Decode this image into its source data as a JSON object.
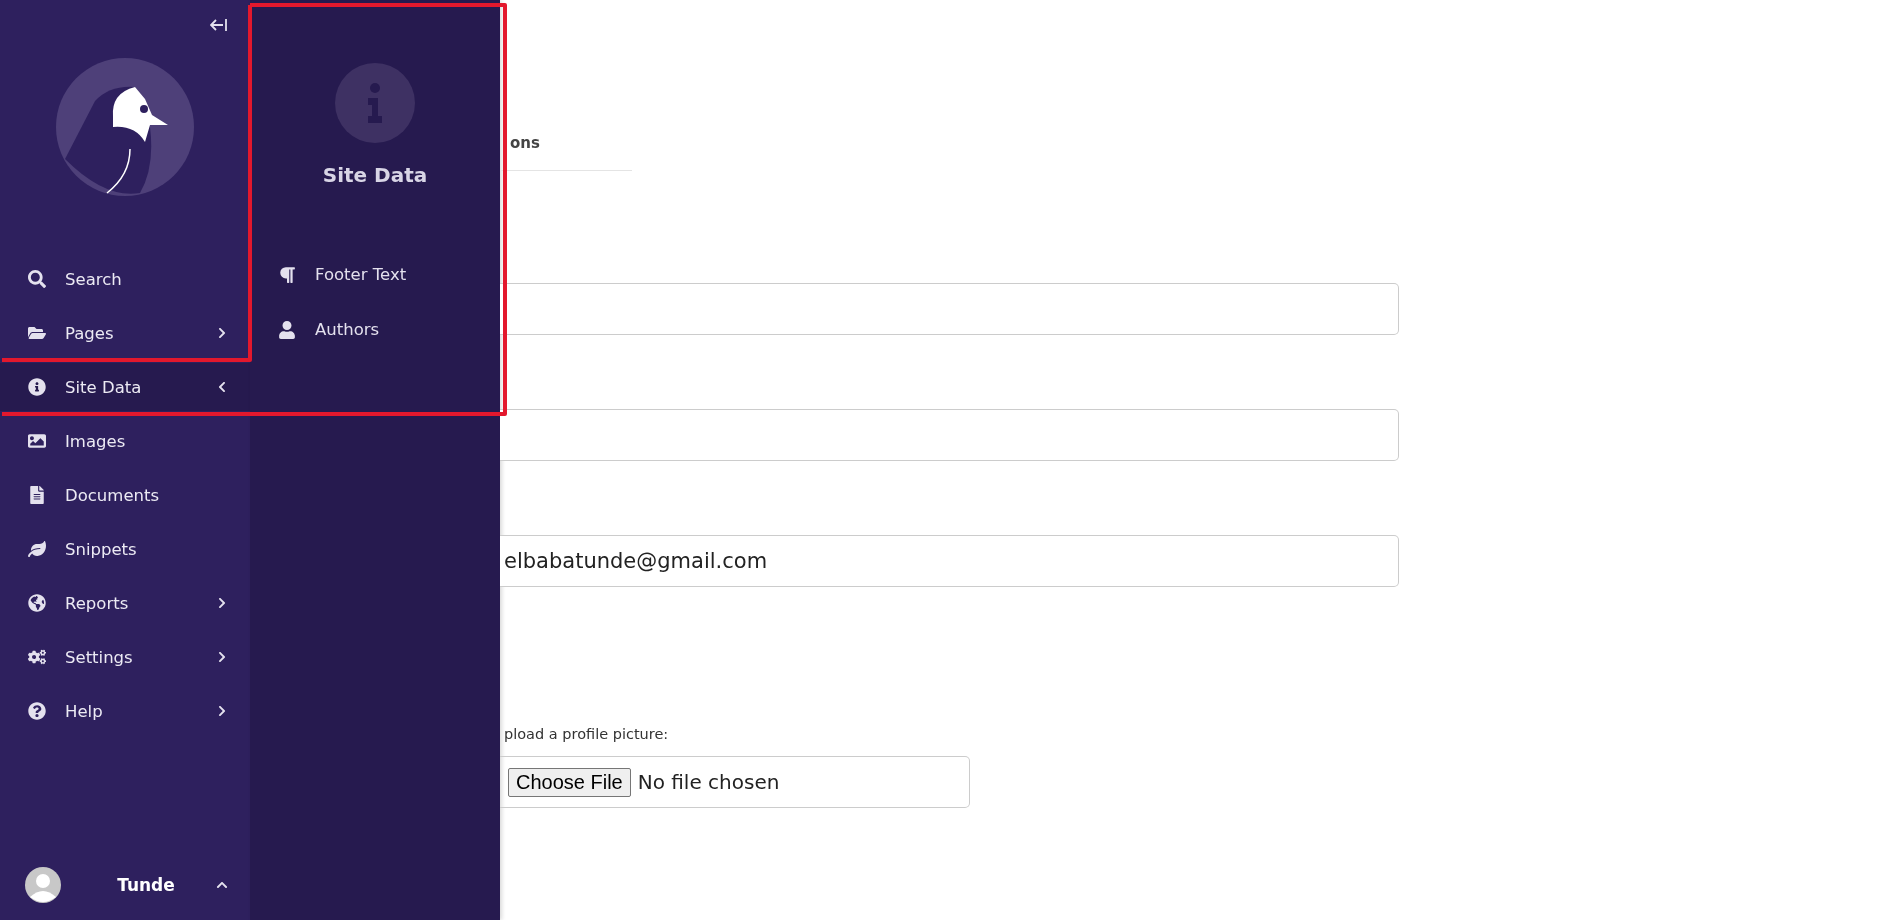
{
  "sidebar": {
    "items": [
      {
        "label": "Search",
        "has_children": false,
        "selected": false
      },
      {
        "label": "Pages",
        "has_children": true,
        "expanded": false,
        "selected": false
      },
      {
        "label": "Site Data",
        "has_children": true,
        "expanded": true,
        "selected": true
      },
      {
        "label": "Images",
        "has_children": false,
        "selected": false
      },
      {
        "label": "Documents",
        "has_children": false,
        "selected": false
      },
      {
        "label": "Snippets",
        "has_children": false,
        "selected": false
      },
      {
        "label": "Reports",
        "has_children": true,
        "expanded": false,
        "selected": false
      },
      {
        "label": "Settings",
        "has_children": true,
        "expanded": false,
        "selected": false
      },
      {
        "label": "Help",
        "has_children": true,
        "expanded": false,
        "selected": false
      }
    ],
    "user": {
      "name": "Tunde",
      "expanded": false
    }
  },
  "submenu": {
    "title": "Site Data",
    "items": [
      {
        "label": "Footer Text"
      },
      {
        "label": "Authors"
      }
    ]
  },
  "content": {
    "tab": {
      "label": "ons"
    },
    "fields": [
      {
        "kind": "text"
      },
      {
        "kind": "text"
      },
      {
        "kind": "text",
        "value": "elbabatunde@gmail.com"
      }
    ],
    "upload": {
      "label": "pload a profile picture:",
      "button": "Choose File",
      "status": "No file chosen"
    }
  }
}
